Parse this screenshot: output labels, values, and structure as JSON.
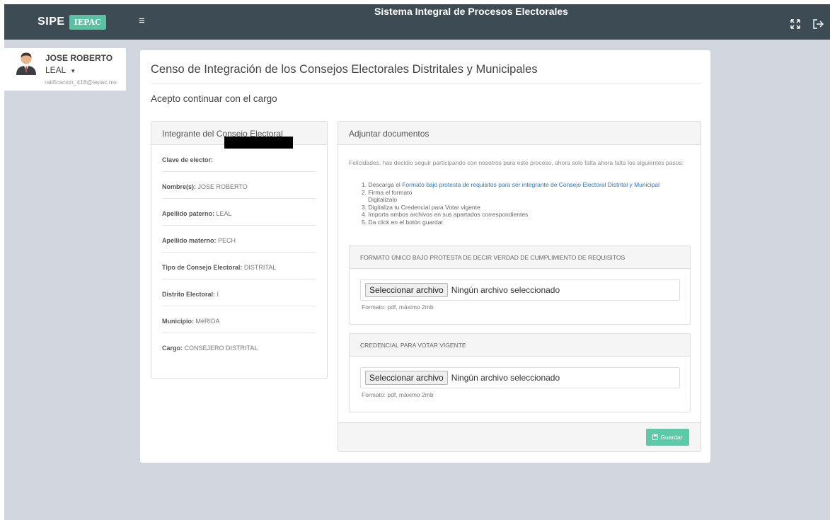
{
  "header": {
    "brand_sipe": "SIPE",
    "brand_iepac": "IEPAC",
    "app_title": "Sistema Integral de Procesos Electorales"
  },
  "user": {
    "first_name": "JOSE ROBERTO",
    "last_name": "LEAL",
    "email": "ratificacion_418@iepac.mx"
  },
  "page": {
    "title": "Censo de Integración de los Consejos Electorales Distritales y Municipales",
    "subtitle": "Acepto continuar con el cargo"
  },
  "member_panel": {
    "heading": "Integrante del Consejo Electoral",
    "fields": [
      {
        "label": "Clave de elector:",
        "value": ""
      },
      {
        "label": "Nombre(s):",
        "value": "JOSE ROBERTO"
      },
      {
        "label": "Apellido paterno:",
        "value": "LEAL"
      },
      {
        "label": "Apellido materno:",
        "value": "PECH"
      },
      {
        "label": "Tipo de Consejo Electoral:",
        "value": "DISTRITAL"
      },
      {
        "label": "Distrito Electoral:",
        "value": "I"
      },
      {
        "label": "Municipio:",
        "value": "MéRIDA"
      },
      {
        "label": "Cargo:",
        "value": "CONSEJERO DISTRITAL"
      }
    ]
  },
  "docs_panel": {
    "heading": "Adjuntar documentos",
    "intro": "Felicidades, has decidio seguir participando con nosotros para este proceso, ahora solo falta ahora falta los siguientes pasos:",
    "step1_prefix": "1. Descarga el",
    "step1_link": "Formato bajo protesta de requisitos para ser integrante de Consejo Electoral Distrital y Municipal",
    "step2": "2. Firma el formato",
    "step2b": "Digitalizalo",
    "step3": "3. Digitaliza tu Credencial para Votar vigente",
    "step4": "4. Importa ambos archivos en sus apartados correspondientes",
    "step5": "5. Da click en el botón guardar",
    "doc1": {
      "title": "FORMATO ÚNICO BAJO PROTESTA DE DECIR VERDAD DE CUMPLIMIENTO DE REQUISITOS",
      "button": "Seleccionar archivo",
      "status": "Ningún archivo seleccionado",
      "hint": "Formato: pdf, máximo 2mb"
    },
    "doc2": {
      "title": "CREDENCIAL PARA VOTAR VIGENTE",
      "button": "Seleccionar archivo",
      "status": "Ningún archivo seleccionado",
      "hint": "Formato: pdf, máximo 2mb"
    },
    "save_label": "Guardar"
  },
  "colors": {
    "topbar": "#3c4b54",
    "accent": "#5cc9a7",
    "background": "#d2d6de"
  },
  "icons": [
    "hamburger-menu-icon",
    "fullscreen-icon",
    "logout-icon",
    "caret-down-icon",
    "save-icon",
    "user-avatar-icon"
  ]
}
